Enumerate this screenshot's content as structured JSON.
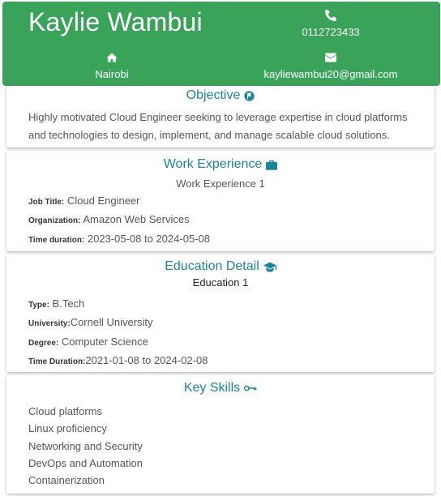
{
  "header": {
    "name": "Kaylie Wambui",
    "phone": "0112723433",
    "location": "Nairobi",
    "email": "kayliewambui20@gmail.com",
    "accent_color": "#3aa35a",
    "icons": {
      "phone": "phone-icon",
      "location": "home-icon",
      "email": "envelope-icon"
    }
  },
  "objective": {
    "title": "Objective",
    "icon": "flag-icon",
    "text": "Highly motivated Cloud Engineer seeking to leverage expertise in cloud platforms and technologies to design, implement, and manage scalable cloud solutions."
  },
  "work": {
    "title": "Work Experience",
    "icon": "briefcase-icon",
    "entry_heading": "Work Experience 1",
    "job_title_label": "Job Title:",
    "job_title": " Cloud Engineer",
    "organization_label": "Organization:",
    "organization": " Amazon Web Services",
    "duration_label": "Time duration:",
    "duration": " 2023-05-08 to 2024-05-08"
  },
  "education": {
    "title": "Education Detail",
    "icon": "graduation-cap-icon",
    "entry_heading": "Education 1",
    "type_label": "Type:",
    "type": " B.Tech",
    "university_label": "University:",
    "university": "Cornell University",
    "degree_label": "Degree:",
    "degree": " Computer Science",
    "duration_label": "Time Duration:",
    "duration": "2021-01-08 to 2024-02-08"
  },
  "skills": {
    "title": "Key Skills",
    "icon": "key-icon",
    "items": [
      "Cloud platforms",
      "Linux proficiency",
      "Networking and Security",
      "DevOps and Automation",
      "Containerization"
    ]
  },
  "title_color": "#17869a"
}
